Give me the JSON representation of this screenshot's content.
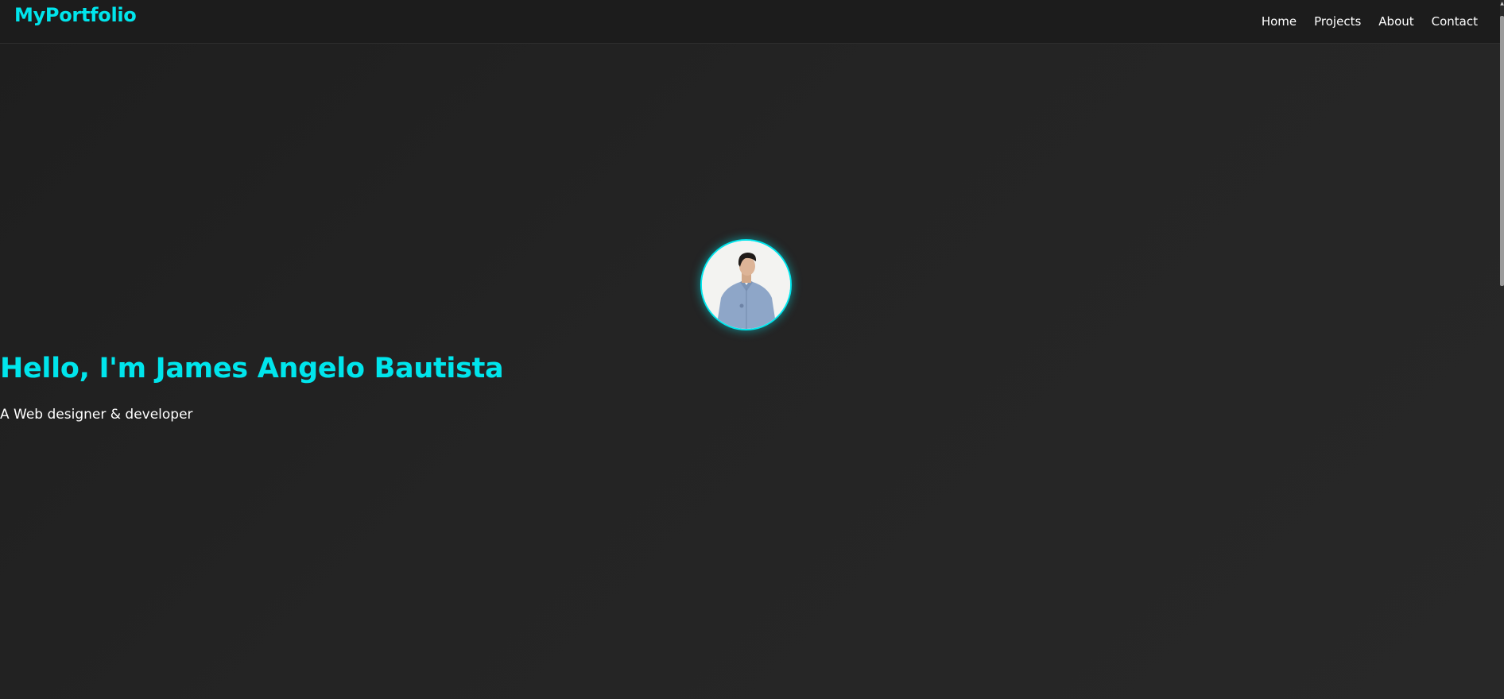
{
  "navbar": {
    "logo": "MyPortfolio",
    "links": [
      {
        "label": "Home"
      },
      {
        "label": "Projects"
      },
      {
        "label": "About"
      },
      {
        "label": "Contact"
      }
    ]
  },
  "hero": {
    "title": "Hello, I'm James Angelo Bautista",
    "subtitle": "A Web designer & developer",
    "avatar_alt": "profile photo"
  },
  "colors": {
    "accent": "#00e5ec",
    "background": "#232323",
    "navbar": "#1c1c1c",
    "text": "#ffffff"
  }
}
